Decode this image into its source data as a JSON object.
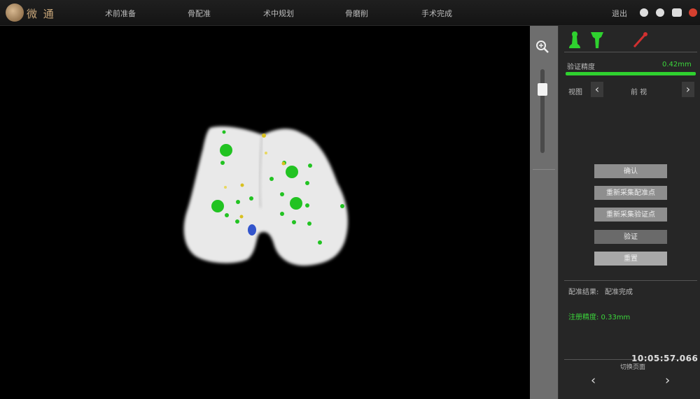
{
  "app": {
    "logo_text": "微 通"
  },
  "topnav": {
    "items": [
      "术前准备",
      "骨配准",
      "术中规划",
      "骨磨削",
      "手术完成"
    ],
    "right_label": "退出"
  },
  "panel": {
    "accuracy_label": "验证精度",
    "accuracy_value": "0.42mm",
    "view_label": "视图",
    "view_value": "前 视",
    "prev_arrow": "‹",
    "next_arrow": "›",
    "buttons": [
      "确认",
      "重新采集配准点",
      "重新采集验证点",
      "验证",
      "重置"
    ],
    "status_title": "配准结果:",
    "status_value": "配准完成",
    "green_result": "注册精度: 0.33mm",
    "timestamp": "10:05:57.066",
    "bottom_label": "切换页面",
    "nav_prev": "‹",
    "nav_next": "›"
  },
  "colors": {
    "accent_green": "#2fd12f",
    "highlight_red": "#d4402f",
    "bone": "#ececec",
    "marker_green": "#22c322",
    "marker_yellow": "#d8c020",
    "marker_blue": "#3355cc"
  }
}
